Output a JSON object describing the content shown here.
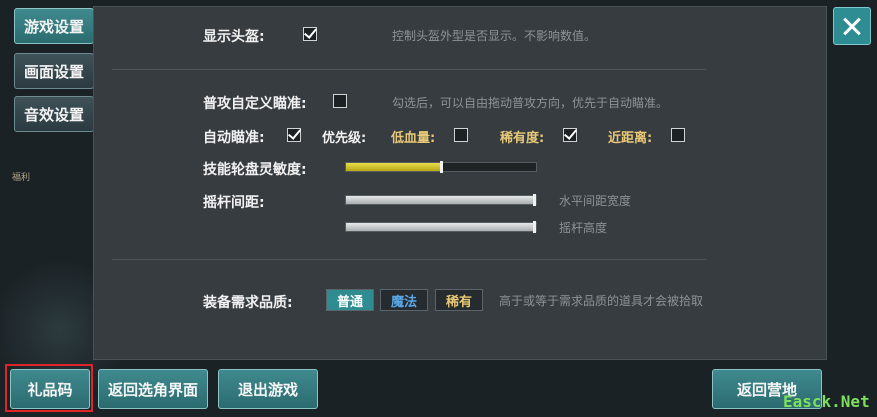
{
  "side_tabs": [
    "游戏设置",
    "画面设置",
    "音效设置"
  ],
  "background_label": "福利",
  "settings": {
    "show_helmet": {
      "label": "显示头盔:",
      "checked": true,
      "hint": "控制头盔外型是否显示。不影响数值。"
    },
    "custom_aim": {
      "label": "普攻自定义瞄准:",
      "checked": false,
      "hint": "勾选后，可以自由拖动普攻方向，优先于自动瞄准。"
    },
    "auto_aim": {
      "label": "自动瞄准:",
      "checked": true
    },
    "priority": {
      "label": "优先级:",
      "low_hp": {
        "label": "低血量:",
        "checked": false
      },
      "rarity": {
        "label": "稀有度:",
        "checked": true
      },
      "near": {
        "label": "近距离:",
        "checked": false
      }
    },
    "skill_wheel": {
      "label": "技能轮盘灵敏度:",
      "value": 0.5
    },
    "joystick": {
      "label": "摇杆间距:",
      "horizontal": {
        "value": 1.0,
        "hint": "水平间距宽度"
      },
      "height": {
        "value": 1.0,
        "hint": "摇杆高度"
      }
    },
    "quality": {
      "label": "装备需求品质:",
      "options": [
        "普通",
        "魔法",
        "稀有"
      ],
      "selected": "普通",
      "hint": "高于或等于需求品质的道具才会被拾取"
    }
  },
  "buttons": {
    "gift_code": "礼品码",
    "back_select": "返回选角界面",
    "quit": "退出游戏",
    "back_camp": "返回营地"
  },
  "watermark": "Easck.Net",
  "colors": {
    "accent": "#2f8d92",
    "highlight_red": "#e0242a",
    "magic": "#5aa8e8",
    "rare": "#e8c877"
  }
}
